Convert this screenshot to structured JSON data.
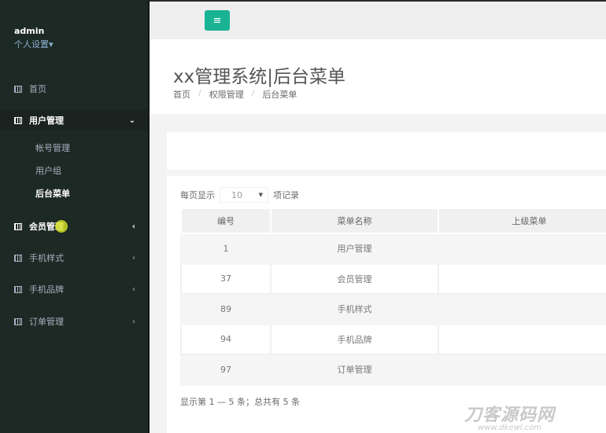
{
  "sidebar": {
    "user": "admin",
    "settings": "个人设置▾",
    "items": [
      {
        "label": "首页"
      },
      {
        "label": "用户管理",
        "sub": [
          "帐号管理",
          "用户组",
          "后台菜单"
        ]
      },
      {
        "label": "会员管理"
      },
      {
        "label": "手机样式"
      },
      {
        "label": "手机品牌"
      },
      {
        "label": "订单管理"
      }
    ]
  },
  "topbar": {
    "menu_icon": "≡"
  },
  "header": {
    "title": "xx管理系统|后台菜单",
    "breadcrumb": [
      "首页",
      "权限管理",
      "后台菜单"
    ]
  },
  "table": {
    "length_prefix": "每页显示",
    "length_value": "10",
    "length_suffix": "项记录",
    "columns": [
      "编号",
      "菜单名称",
      "上级菜单"
    ],
    "rows": [
      [
        "1",
        "用户管理",
        ""
      ],
      [
        "37",
        "会员管理",
        ""
      ],
      [
        "89",
        "手机样式",
        ""
      ],
      [
        "94",
        "手机品牌",
        ""
      ],
      [
        "97",
        "订单管理",
        ""
      ]
    ],
    "info": "显示第 1 — 5 条；总共有 5 条"
  },
  "watermark": {
    "name": "刀客源码网",
    "url": "www.dkewl.com"
  },
  "colors": {
    "accent": "#1ab394",
    "sidebar": "#1d2924"
  }
}
